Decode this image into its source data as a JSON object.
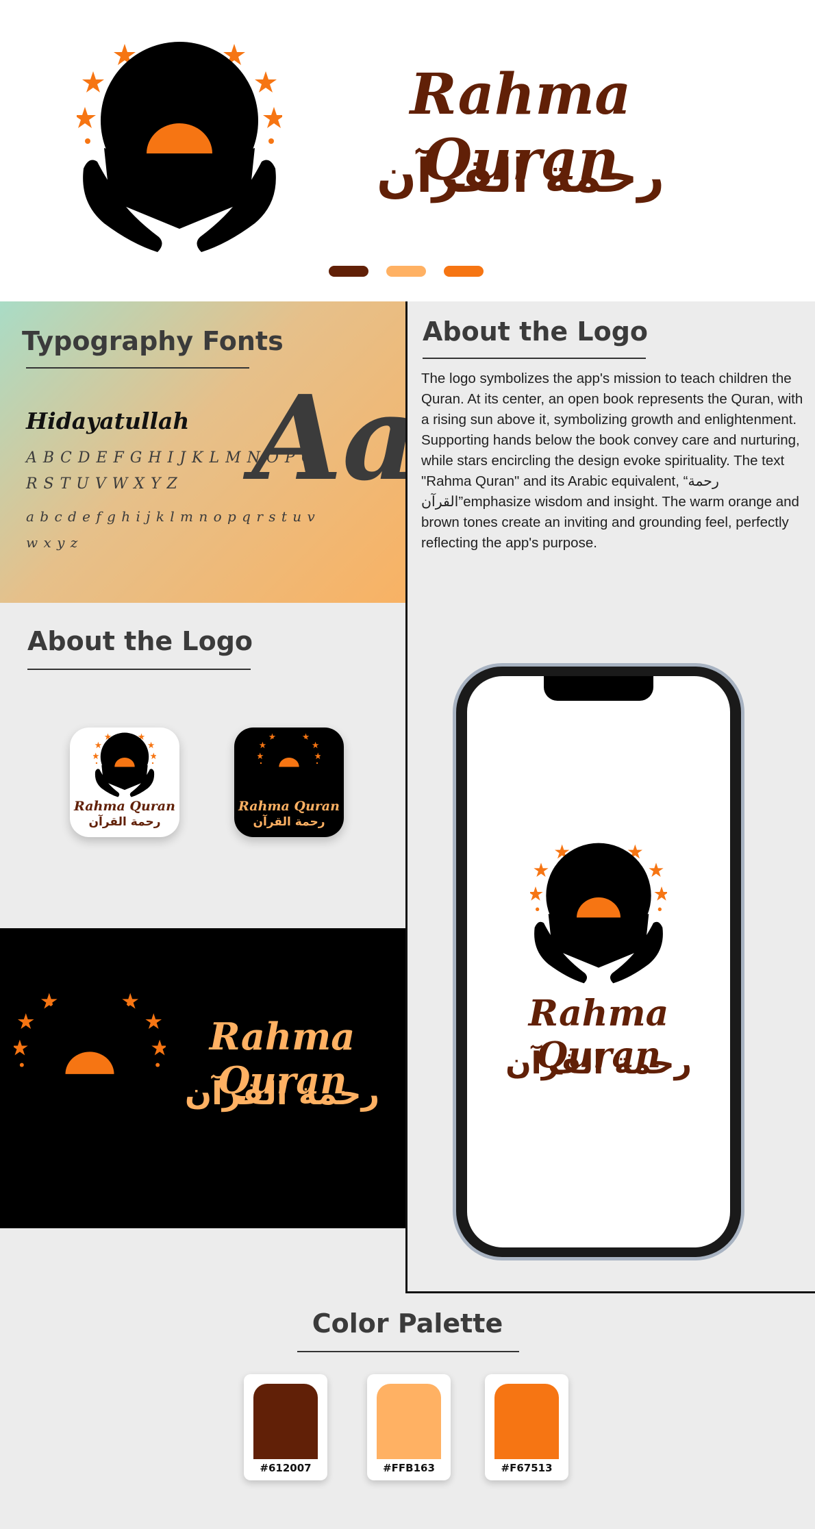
{
  "brand": {
    "name_en": "Rahma Quran",
    "name_ar": "رحمة القرآن"
  },
  "colors": {
    "brown": "#612007",
    "light_orange": "#FFB163",
    "orange": "#F67513"
  },
  "typography": {
    "heading": "Typography Fonts",
    "font_name": "Hidayatullah",
    "uppercase_line1": "A B C D E F G H I J K L M N O P Q",
    "uppercase_line2": "R S T U V W X Y Z",
    "lowercase_line1": "a b c d e f g h i j k l m n o p q r s t u v",
    "lowercase_line2": "w x y z",
    "sample": "Aa"
  },
  "about_right": {
    "heading": "About the Logo",
    "body": "The logo symbolizes the app's mission to teach children the Quran. At its center, an open book represents the Quran, with a rising sun above it, symbolizing growth and enlightenment. Supporting hands below the book convey care and nurturing, while stars encircling the design evoke spirituality. The text \"Rahma Quran\" and its Arabic equivalent, “رحمة القرآن”emphasize wisdom and insight. The warm orange and brown tones create an inviting and grounding feel, perfectly reflecting the app's purpose."
  },
  "about_left": {
    "heading": "About the Logo"
  },
  "palette": {
    "heading": "Color Palette",
    "swatches": [
      {
        "code": "#612007",
        "color": "#612007"
      },
      {
        "code": "#FFB163",
        "color": "#FFB163"
      },
      {
        "code": "#F67513",
        "color": "#F67513"
      }
    ]
  },
  "icons": [
    "logo-emblem-icon",
    "star-icon",
    "book-icon",
    "hands-icon",
    "cap-icon",
    "sun-icon"
  ]
}
